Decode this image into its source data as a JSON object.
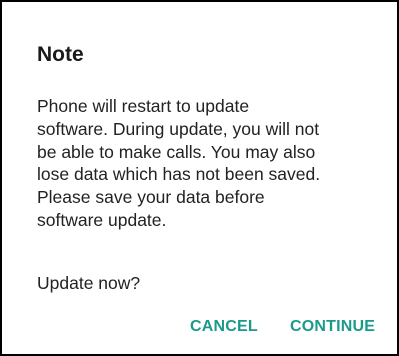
{
  "dialog": {
    "title": "Note",
    "message_lines": [
      "Phone will restart to update",
      "software. During update, you will not",
      "be able to make calls. You may also",
      "lose data which has not been saved.",
      "Please save your data before",
      "software update."
    ],
    "prompt": "Update now?",
    "cancel_label": "CANCEL",
    "continue_label": "CONTINUE",
    "accent_color": "#1a9a8a"
  }
}
